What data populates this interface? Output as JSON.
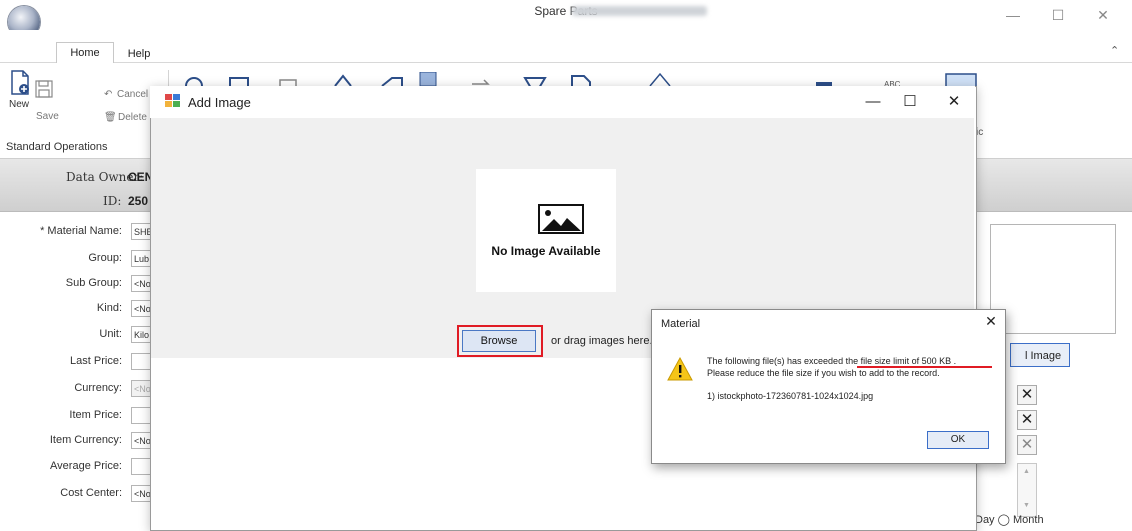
{
  "window": {
    "title": "Spare Parts",
    "controls": {
      "minimize": "—",
      "maximize": "☐",
      "close": "✕"
    },
    "collapse_ribbon": "⌃"
  },
  "tabs": [
    {
      "label": "Home"
    },
    {
      "label": "Help"
    }
  ],
  "ribbon": {
    "new_label": "New",
    "save_label": "Save",
    "cancel_label": "Cancel",
    "delete_label": "Delete",
    "group_label": "Standard Operations",
    "partial_label": "ABC",
    "partial_label2": "ic"
  },
  "record": {
    "data_owner_label": "Data Owner:",
    "data_owner_value": "CEN",
    "id_label": "ID:",
    "id_value": "250"
  },
  "form": {
    "fields": [
      {
        "label": "* Material Name:",
        "value": "SHE"
      },
      {
        "label": "Group:",
        "value": "Lub"
      },
      {
        "label": "Sub Group:",
        "value": "<No"
      },
      {
        "label": "Kind:",
        "value": "<No"
      },
      {
        "label": "Unit:",
        "value": "Kilo"
      },
      {
        "label": "Last Price:",
        "value": ""
      },
      {
        "label": "Currency:",
        "value": "<No"
      },
      {
        "label": "Item Price:",
        "value": ""
      },
      {
        "label": "Item Currency:",
        "value": "<No"
      },
      {
        "label": "Average Price:",
        "value": ""
      },
      {
        "label": "Cost Center:",
        "value": "<No"
      }
    ],
    "image_button_label": "l Image",
    "remove_icon": "✕",
    "bottom_options": "Day  ◯  Month"
  },
  "add_image_dialog": {
    "title": "Add Image",
    "controls": {
      "minimize": "—",
      "maximize": "☐",
      "close": "✕"
    },
    "no_image_text": "No Image Available",
    "browse_label": "Browse",
    "drag_text": "or drag images here."
  },
  "material_dialog": {
    "title": "Material",
    "close": "✕",
    "message_line1": "The following file(s)  has exceeded the file size limit of 500 KB .",
    "message_line2": "Please reduce the file size if you wish to add to the record.",
    "file_entry": "1) istockphoto-172360781-1024x1024.jpg",
    "ok_label": "OK"
  },
  "colors": {
    "highlight_red": "#e01b24",
    "button_blue": "#3b6ec8",
    "warning_yellow": "#f5c518"
  }
}
